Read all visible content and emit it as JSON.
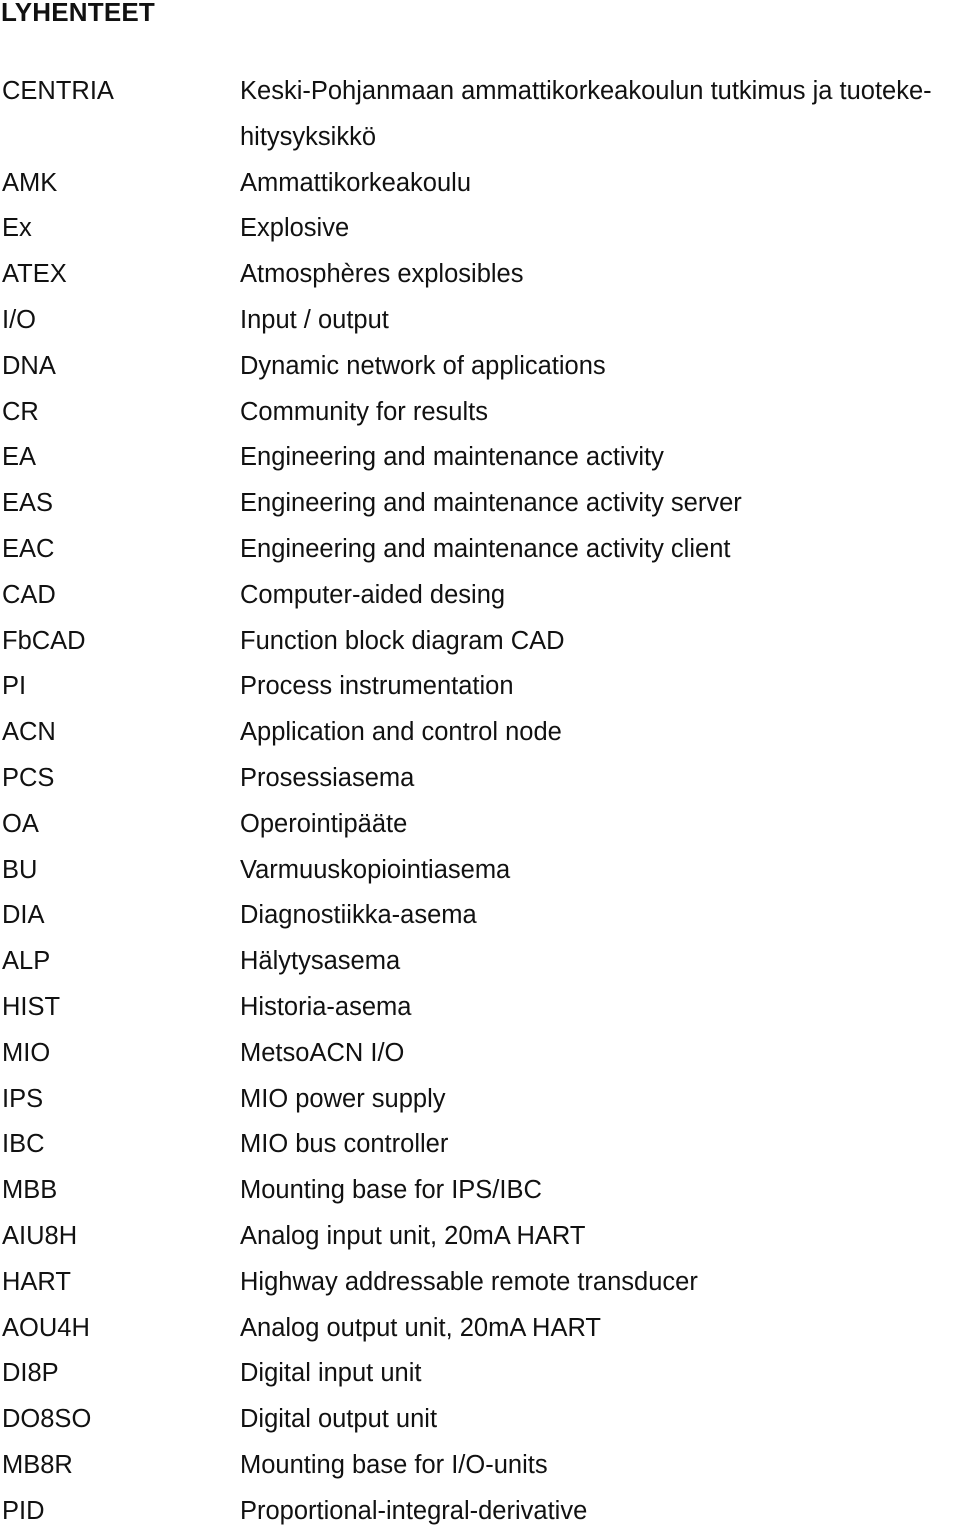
{
  "document": {
    "title": "LYHENTEET",
    "entries": [
      {
        "abbr": "CENTRIA",
        "definition": "Keski-Pohjanmaan ammattikorkeakoulun tutkimus ja tuoteke-",
        "definition_cont": "hitysyksikkö"
      },
      {
        "abbr": "AMK",
        "definition": "Ammattikorkeakoulu"
      },
      {
        "abbr": "Ex",
        "definition": "Explosive"
      },
      {
        "abbr": "ATEX",
        "definition": "Atmosphères explosibles"
      },
      {
        "abbr": "I/O",
        "definition": "Input / output"
      },
      {
        "abbr": "DNA",
        "definition": "Dynamic network of applications"
      },
      {
        "abbr": "CR",
        "definition": "Community for results"
      },
      {
        "abbr": "EA",
        "definition": "Engineering and maintenance activity"
      },
      {
        "abbr": "EAS",
        "definition": "Engineering and maintenance activity server"
      },
      {
        "abbr": "EAC",
        "definition": "Engineering and maintenance activity client"
      },
      {
        "abbr": "CAD",
        "definition": "Computer-aided desing"
      },
      {
        "abbr": "FbCAD",
        "definition": "Function block diagram CAD"
      },
      {
        "abbr": "PI",
        "definition": "Process instrumentation"
      },
      {
        "abbr": "ACN",
        "definition": "Application and control node"
      },
      {
        "abbr": "PCS",
        "definition": "Prosessiasema"
      },
      {
        "abbr": "OA",
        "definition": "Operointipääte"
      },
      {
        "abbr": "BU",
        "definition": "Varmuuskopiointiasema"
      },
      {
        "abbr": "DIA",
        "definition": "Diagnostiikka-asema"
      },
      {
        "abbr": "ALP",
        "definition": "Hälytysasema"
      },
      {
        "abbr": "HIST",
        "definition": "Historia-asema"
      },
      {
        "abbr": "MIO",
        "definition": "MetsoACN I/O"
      },
      {
        "abbr": "IPS",
        "definition": "MIO power supply"
      },
      {
        "abbr": "IBC",
        "definition": "MIO bus controller"
      },
      {
        "abbr": "MBB",
        "definition": "Mounting base for IPS/IBC"
      },
      {
        "abbr": "AIU8H",
        "definition": "Analog input unit, 20mA HART"
      },
      {
        "abbr": "HART",
        "definition": "Highway addressable remote transducer"
      },
      {
        "abbr": "AOU4H",
        "definition": "Analog output unit, 20mA HART"
      },
      {
        "abbr": "DI8P",
        "definition": "Digital input unit"
      },
      {
        "abbr": "DO8SO",
        "definition": "Digital output unit"
      },
      {
        "abbr": "MB8R",
        "definition": "Mounting base for I/O-units"
      },
      {
        "abbr": "PID",
        "definition": "Proportional-integral-derivative"
      }
    ]
  }
}
